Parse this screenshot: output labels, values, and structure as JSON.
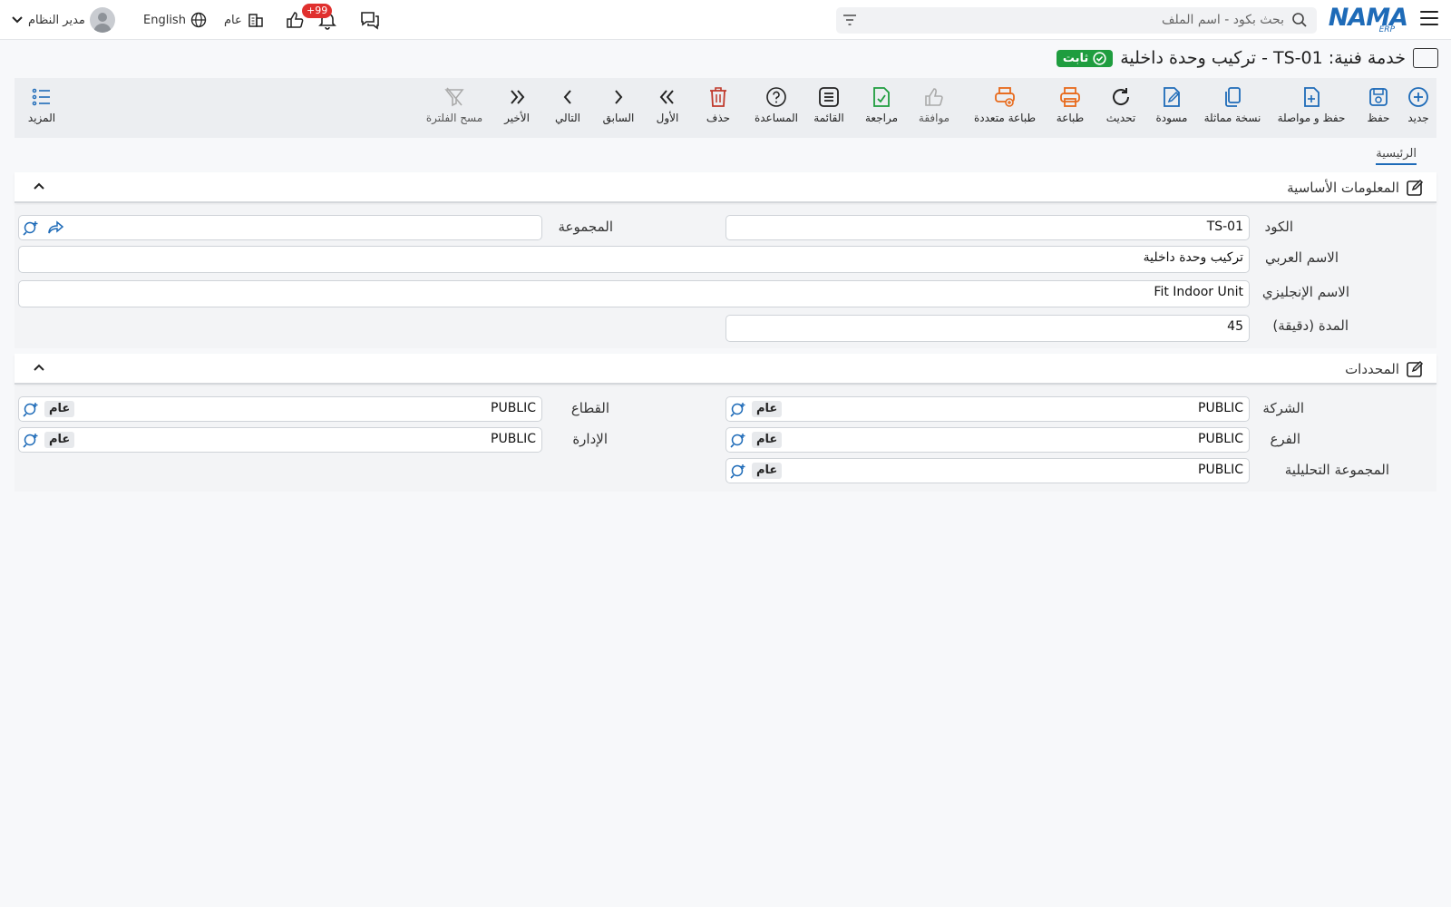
{
  "header": {
    "logo_text": "NAMA",
    "logo_sub": "ERP",
    "search_placeholder": "بحث بكود - اسم الملف",
    "notifications_badge": "+99",
    "company_label": "عام",
    "language_label": "English",
    "user_name": "مدير النظام"
  },
  "page": {
    "title": "خدمة فنية: TS-01 - تركيب وحدة داخلية",
    "status": "ثابت"
  },
  "toolbar": [
    {
      "label": "جديد",
      "icon": "plus-circle-icon",
      "color": "#1e6bb8"
    },
    {
      "label": "حفظ",
      "icon": "save-icon",
      "color": "#1e6bb8"
    },
    {
      "label": "حفظ و مواصلة",
      "icon": "save-continue-icon",
      "color": "#1e6bb8"
    },
    {
      "label": "نسخة مماثلة",
      "icon": "copy-icon",
      "color": "#1e6bb8"
    },
    {
      "label": "مسودة",
      "icon": "draft-edit-icon",
      "color": "#1e6bb8"
    },
    {
      "label": "تحديث",
      "icon": "refresh-icon",
      "color": "#222"
    },
    {
      "label": "طباعة",
      "icon": "print-icon",
      "color": "#e86a1c"
    },
    {
      "label": "طباعة متعددة",
      "icon": "multi-print-icon",
      "color": "#e86a1c"
    },
    {
      "label": "موافقة",
      "icon": "thumbs-up-icon",
      "color": "#aaa"
    },
    {
      "label": "مراجعة",
      "icon": "review-check-icon",
      "color": "#1f9d3f"
    },
    {
      "label": "القائمة",
      "icon": "list-icon",
      "color": "#222"
    },
    {
      "label": "المساعدة",
      "icon": "help-icon",
      "color": "#222"
    },
    {
      "label": "حذف",
      "icon": "trash-icon",
      "color": "#c0392b"
    },
    {
      "label": "الأول",
      "icon": "first-icon",
      "color": "#222"
    },
    {
      "label": "السابق",
      "icon": "prev-icon",
      "color": "#222"
    },
    {
      "label": "التالي",
      "icon": "next-icon",
      "color": "#222"
    },
    {
      "label": "الأخير",
      "icon": "last-icon",
      "color": "#222"
    },
    {
      "label": "مسح الفلترة",
      "icon": "clear-filter-icon",
      "color": "#aaa"
    }
  ],
  "more_label": "المزيد",
  "tabs": {
    "main": "الرئيسية"
  },
  "basic_info": {
    "title": "المعلومات الأساسية",
    "code_label": "الكود",
    "code_value": "TS-01",
    "group_label": "المجموعة",
    "group_value": "",
    "arabic_name_label": "الاسم العربي",
    "arabic_name_value": "تركيب وحدة داخلية",
    "english_name_label": "الاسم الإنجليزي",
    "english_name_value": "Fit Indoor Unit",
    "duration_label": "المدة (دقيقة)",
    "duration_value": "45"
  },
  "dimensions": {
    "title": "المحددات",
    "company_label": "الشركة",
    "company_value": "PUBLIC",
    "company_tag": "عام",
    "sector_label": "القطاع",
    "sector_value": "PUBLIC",
    "sector_tag": "عام",
    "branch_label": "الفرع",
    "branch_value": "PUBLIC",
    "branch_tag": "عام",
    "department_label": "الإدارة",
    "department_value": "PUBLIC",
    "department_tag": "عام",
    "analysis_label": "المجموعة التحليلية",
    "analysis_value": "PUBLIC",
    "analysis_tag": "عام"
  }
}
